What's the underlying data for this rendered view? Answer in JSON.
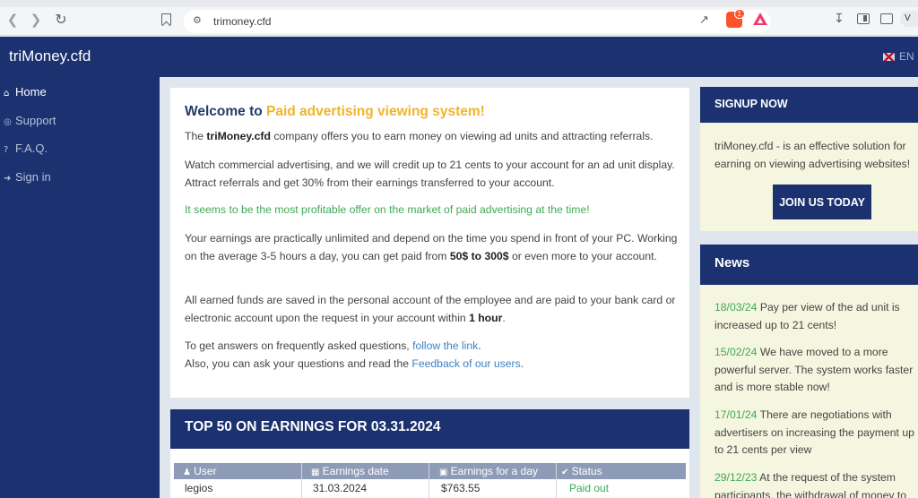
{
  "browser": {
    "url": "trimoney.cfd",
    "profile_label": "V"
  },
  "header": {
    "brand": "triMoney.cfd",
    "lang": "EN"
  },
  "sidebar": {
    "items": [
      {
        "label": "Home"
      },
      {
        "label": "Support"
      },
      {
        "label": "F.A.Q."
      },
      {
        "label": "Sign in"
      }
    ]
  },
  "main": {
    "welcome_prefix": "Welcome to ",
    "welcome_highlight": "Paid advertising viewing system!",
    "p1_a": "The ",
    "p1_b": "triMoney.cfd",
    "p1_c": " company offers you to earn money on viewing ad units and attracting referrals.",
    "p2": "Watch commercial advertising, and we will credit up to 21 cents to your account for an ad unit display. Attract referrals and get 30% from their earnings transferred to your account.",
    "p3": "It seems to be the most profitable offer on the market of paid advertising at the time!",
    "p4_a": "Your earnings are practically unlimited and depend on the time you spend in front of your PC. Working on the average 3-5 hours a day, you can get paid from ",
    "p4_b": "50$ to 300$",
    "p4_c": " or even more to your account.",
    "p5_a": "All earned funds are saved in the personal account of the employee and are paid to your bank card or electronic account upon the request in your account within ",
    "p5_b": "1 hour",
    "p5_c": ".",
    "p6_a": "To get answers on frequently asked questions, ",
    "p6_link": "follow the link",
    "p6_b": ".",
    "p7_a": "Also, you can ask your questions and read the ",
    "p7_link": "Feedback of our users",
    "p7_b": "."
  },
  "top50": {
    "title": "TOP 50 ON EARNINGS FOR 03.31.2024",
    "columns": [
      "User",
      "Earnings date",
      "Earnings for a day",
      "Status"
    ],
    "rows": [
      {
        "user": "legios",
        "date": "31.03.2024",
        "amount": "$763.55",
        "status": "Paid out"
      }
    ]
  },
  "signup": {
    "title": "SIGNUP NOW",
    "text": "triMoney.cfd - is an effective solution for earning on viewing advertising websites!",
    "button": "JOIN US TODAY"
  },
  "news": {
    "title": "News",
    "items": [
      {
        "date": "18/03/24",
        "text": " Pay per view of the ad unit is increased up to 21 cents!"
      },
      {
        "date": "15/02/24",
        "text": " We have moved to a more powerful server. The system works faster and is more stable now!"
      },
      {
        "date": "17/01/24",
        "text": " There are negotiations with advertisers on increasing the payment up to 21 cents per view"
      },
      {
        "date": "29/12/23",
        "text": " At the request of the system participants, the withdrawal of money to"
      }
    ]
  },
  "colors": {
    "navy": "#1b3170",
    "accent_yellow": "#f0b429",
    "green": "#3daa55",
    "link": "#3b82c4"
  }
}
